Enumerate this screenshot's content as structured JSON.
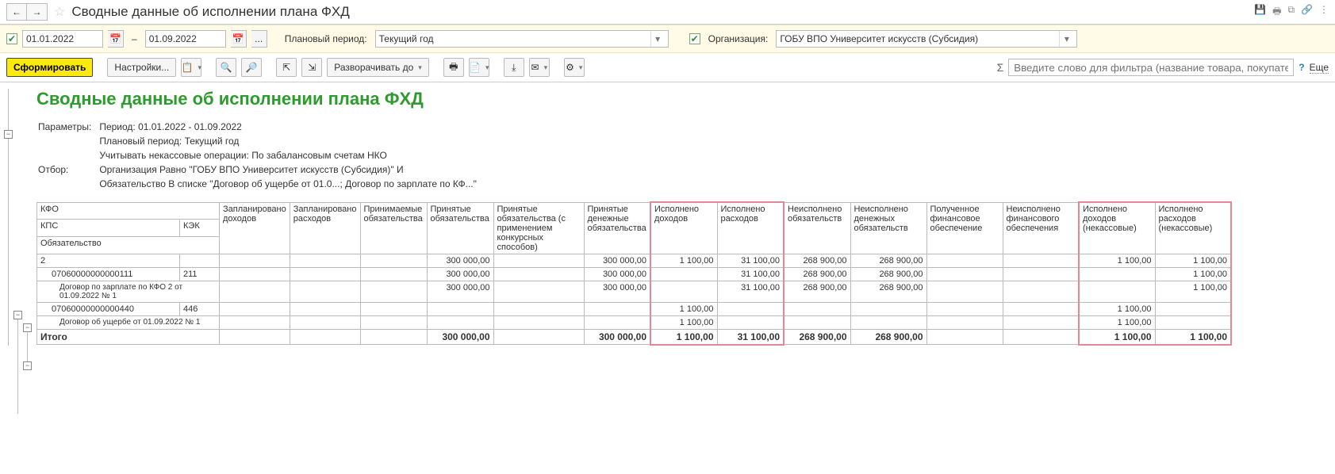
{
  "titlebar": {
    "title": "Сводные данные об исполнении плана ФХД"
  },
  "filterbar": {
    "date_from": "01.01.2022",
    "date_to": "01.09.2022",
    "plan_period_label": "Плановый период:",
    "plan_period_value": "Текущий год",
    "org_label": "Организация:",
    "org_value": "ГОБУ ВПО Университет искусств (Субсидия)"
  },
  "toolbar": {
    "form_label": "Сформировать",
    "settings_label": "Настройки...",
    "expand_label": "Разворачивать до",
    "filter_placeholder": "Введите слово для фильтра (название товара, покупателя и пр.)",
    "sigma": "Σ",
    "more": "Еще"
  },
  "report": {
    "title": "Сводные данные об исполнении плана ФХД",
    "params_label": "Параметры:",
    "params": [
      "Период: 01.01.2022 - 01.09.2022",
      "Плановый период: Текущий год",
      "Учитывать некассовые операции: По забалансовым счетам НКО"
    ],
    "selection_label": "Отбор:",
    "selection": [
      "Организация Равно \"ГОБУ ВПО Университет искусств (Субсидия)\" И",
      "Обязательство В списке \"Договор об ущербе от 01.0...; Договор по зарплате по КФ...\""
    ]
  },
  "grid": {
    "dim_headers": {
      "kfo": "КФО",
      "kps": "КПС",
      "kek": "КЭК",
      "obligation": "Обязательство"
    },
    "cols": [
      "Запланировано доходов",
      "Запланировано расходов",
      "Принимаемые обязательства",
      "Принятые обязательства",
      "Принятые обязательства (с применением конкурсных способов)",
      "Принятые денежные обязательства",
      "Исполнено доходов",
      "Исполнено расходов",
      "Неисполнено обязательств",
      "Неисполнено денежных обязательств",
      "Полученное финансовое обеспечение",
      "Неисполнено финансового обеспечения",
      "Исполнено доходов (некассовые)",
      "Исполнено расходов (некассовые)"
    ],
    "rows": [
      {
        "label": "2",
        "kek": "",
        "indent": 0,
        "v": [
          "",
          "",
          "",
          "300 000,00",
          "",
          "300 000,00",
          "1 100,00",
          "31 100,00",
          "268 900,00",
          "268 900,00",
          "",
          "",
          "1 100,00",
          "1 100,00"
        ]
      },
      {
        "label": "07060000000000111",
        "kek": "211",
        "indent": 1,
        "v": [
          "",
          "",
          "",
          "300 000,00",
          "",
          "300 000,00",
          "",
          "31 100,00",
          "268 900,00",
          "268 900,00",
          "",
          "",
          "",
          "1 100,00"
        ]
      },
      {
        "label": "Договор по зарплате по КФО 2 от 01.09.2022 № 1",
        "kek": "",
        "indent": 2,
        "v": [
          "",
          "",
          "",
          "300 000,00",
          "",
          "300 000,00",
          "",
          "31 100,00",
          "268 900,00",
          "268 900,00",
          "",
          "",
          "",
          "1 100,00"
        ]
      },
      {
        "label": "07060000000000440",
        "kek": "446",
        "indent": 1,
        "v": [
          "",
          "",
          "",
          "",
          "",
          "",
          "1 100,00",
          "",
          "",
          "",
          "",
          "",
          "1 100,00",
          ""
        ]
      },
      {
        "label": "Договор об ущербе от 01.09.2022 № 1",
        "kek": "",
        "indent": 2,
        "v": [
          "",
          "",
          "",
          "",
          "",
          "",
          "1 100,00",
          "",
          "",
          "",
          "",
          "",
          "1 100,00",
          ""
        ]
      }
    ],
    "total_label": "Итого",
    "total": [
      "",
      "",
      "",
      "300 000,00",
      "",
      "300 000,00",
      "1 100,00",
      "31 100,00",
      "268 900,00",
      "268 900,00",
      "",
      "",
      "1 100,00",
      "1 100,00"
    ]
  }
}
